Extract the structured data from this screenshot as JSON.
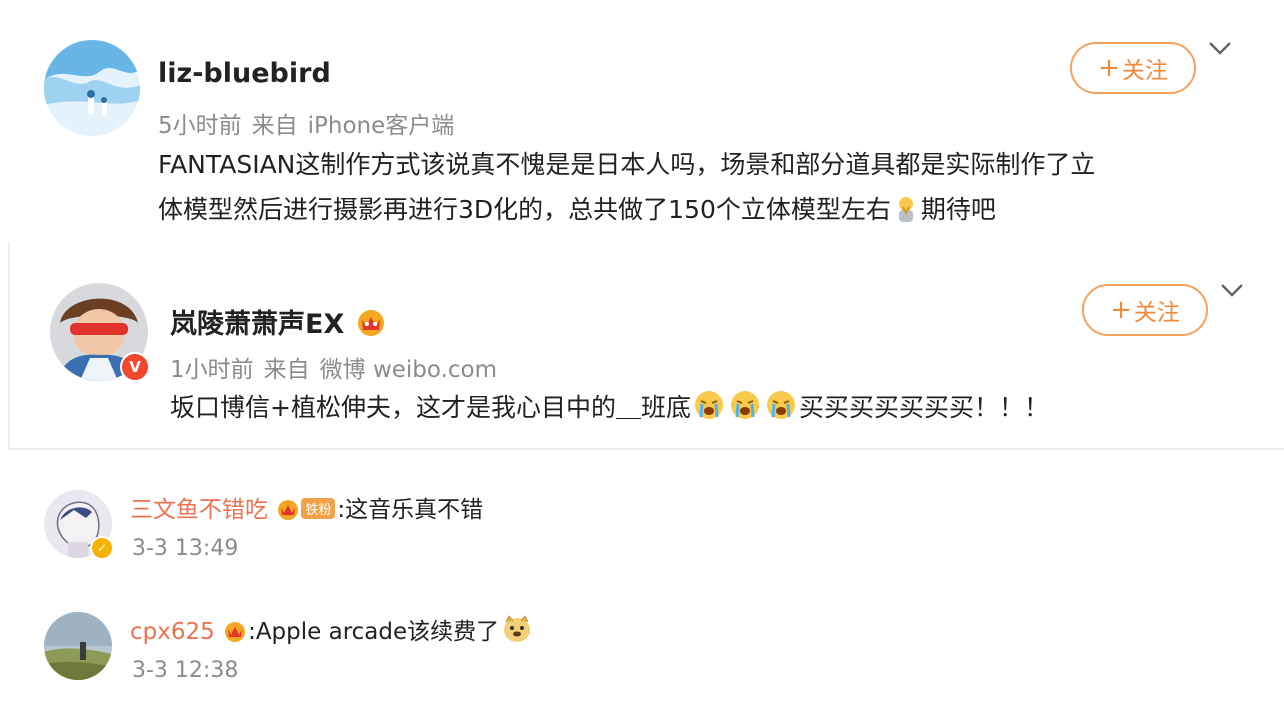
{
  "post": {
    "username": "liz-bluebird",
    "time": "5小时前",
    "source_prefix": "来自",
    "source": "iPhone客户端",
    "text_line1": "FANTASIAN这制作方式该说真不愧是是日本人吗，场景和部分道具都是实际制作了立",
    "text_line2": "体模型然后进行摄影再进行3D化的，总共做了150个立体模型左右",
    "text_tail": "期待吧",
    "follow_label": "关注"
  },
  "repost": {
    "username": "岚陵萧萧声EX",
    "time": "1小时前",
    "source_prefix": "来自",
    "source": "微博 weibo.com",
    "text": "坂口博信+植松伸夫，这才是我心目中的＿班底",
    "text_tail": "买买买买买买买！！！",
    "follow_label": "关注",
    "verified_glyph": "V"
  },
  "comments": [
    {
      "username": "三文鱼不错吃",
      "badge": "铁粉",
      "text": ":这音乐真不错",
      "time": "3-3 13:49"
    },
    {
      "username": "cpx625",
      "text": ":Apple arcade该续费了",
      "time": "3-3 12:38"
    }
  ],
  "colors": {
    "accent_orange": "#f08a3c",
    "username_orange": "#eb7350",
    "meta_gray": "#8c8c8c"
  },
  "icons": {
    "follow": "plus-icon",
    "menu": "chevron-down-icon",
    "member": "crown-icon",
    "emoji_pray": "pray-emoji-icon",
    "emoji_cry": "crying-emoji-icon",
    "emoji_doge": "doge-emoji-icon"
  }
}
